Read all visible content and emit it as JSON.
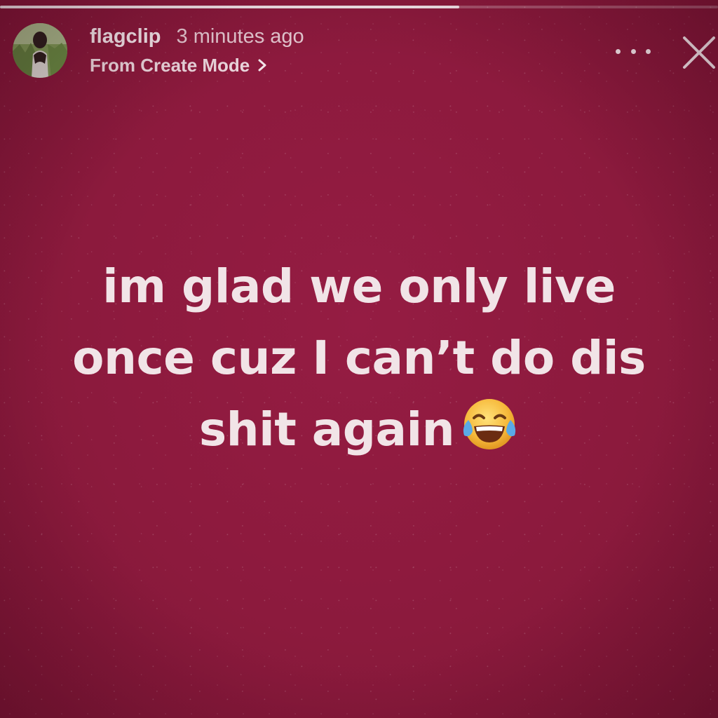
{
  "story": {
    "progress": 0.64,
    "background_color": "#8e1a3e",
    "text_color": "#f1e4e7"
  },
  "header": {
    "username": "flagclip",
    "timestamp": "3 minutes ago",
    "source_label": "From Create Mode",
    "source_icon": "chevron-right-icon",
    "more_icon": "more-dots-icon",
    "close_icon": "close-icon"
  },
  "caption": {
    "lines": [
      "im glad we only live",
      "once cuz I can’t do dis",
      "shit again"
    ],
    "emoji": "face-with-tears-of-joy"
  }
}
